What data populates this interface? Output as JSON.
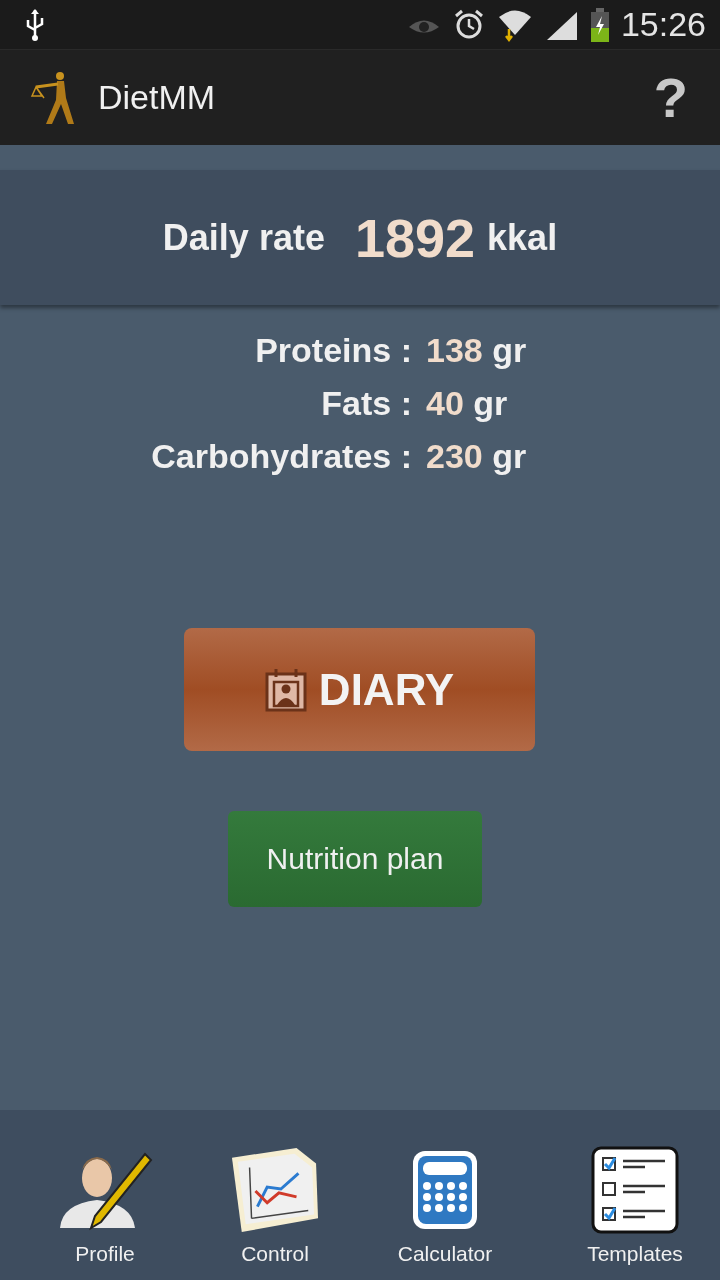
{
  "status_bar": {
    "time": "15:26"
  },
  "app_bar": {
    "title": "DietMM",
    "help": "?"
  },
  "daily_rate": {
    "label": "Daily rate",
    "value": "1892",
    "unit": "kkal"
  },
  "macros": [
    {
      "label": "Proteins :",
      "value": "138",
      "unit": "gr"
    },
    {
      "label": "Fats :",
      "value": "40",
      "unit": "gr"
    },
    {
      "label": "Carbohydrates :",
      "value": "230",
      "unit": "gr"
    }
  ],
  "diary_button": "DIARY",
  "plan_button": "Nutrition plan",
  "nav": [
    {
      "label": "Profile"
    },
    {
      "label": "Control"
    },
    {
      "label": "Calculator"
    },
    {
      "label": "Templates"
    }
  ]
}
